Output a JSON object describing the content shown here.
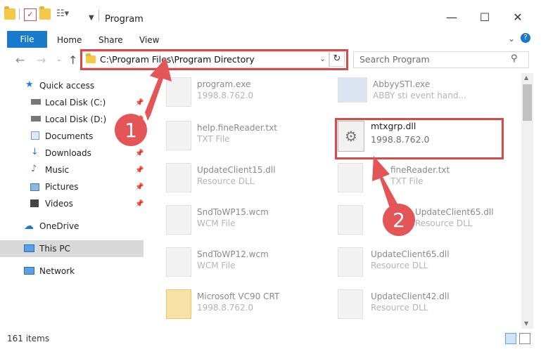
{
  "window": {
    "title": "Program"
  },
  "ribbon": {
    "tabs": [
      "File",
      "Home",
      "Share",
      "View"
    ]
  },
  "address": {
    "path": "C:\\Program Files\\Program Directory"
  },
  "search": {
    "placeholder": "Search Program"
  },
  "sidebar": {
    "items": [
      {
        "label": "Quick access",
        "icon": "star-icon"
      },
      {
        "label": "Local Disk (C:)",
        "icon": "drive-icon"
      },
      {
        "label": "Local Disk (D:)",
        "icon": "drive-icon"
      },
      {
        "label": "Documents",
        "icon": "documents-icon"
      },
      {
        "label": "Downloads",
        "icon": "download-icon"
      },
      {
        "label": "Music",
        "icon": "music-icon"
      },
      {
        "label": "Pictures",
        "icon": "pictures-icon"
      },
      {
        "label": "Videos",
        "icon": "videos-icon"
      },
      {
        "label": "OneDrive",
        "icon": "cloud-icon"
      },
      {
        "label": "This PC",
        "icon": "computer-icon"
      },
      {
        "label": "Network",
        "icon": "network-icon"
      }
    ]
  },
  "files": [
    {
      "name": "program.exe",
      "desc": "1998.8.762.0"
    },
    {
      "name": "AbbyySTI.exe",
      "desc": "ABBY sti event hand..."
    },
    {
      "name": "help.fineReader.txt",
      "desc": "TXT File"
    },
    {
      "name": "mtxgrp.dll",
      "desc": "1998.8.762.0"
    },
    {
      "name": "UpdateClient15.dll",
      "desc": "Resource DLL"
    },
    {
      "name": "fineReader.txt",
      "desc": "TXT File"
    },
    {
      "name": "SndToWP15.wcm",
      "desc": "WCM File"
    },
    {
      "name": "UpdateClient65.dll",
      "desc": "Resource DLL"
    },
    {
      "name": "SndToWP12.wcm",
      "desc": "WCM File"
    },
    {
      "name": "UpdateClient65.dll",
      "desc": "Resource DLL"
    },
    {
      "name": "Microsoft VC90 CRT",
      "desc": "1998.8.762.0"
    },
    {
      "name": "UpdateClient42.dll",
      "desc": "Resource DLL"
    }
  ],
  "status": {
    "count": "161 items"
  },
  "annotations": {
    "badge1": "1",
    "badge2": "2"
  },
  "colors": {
    "accent": "#1979ca",
    "highlight": "#d84a4a"
  }
}
